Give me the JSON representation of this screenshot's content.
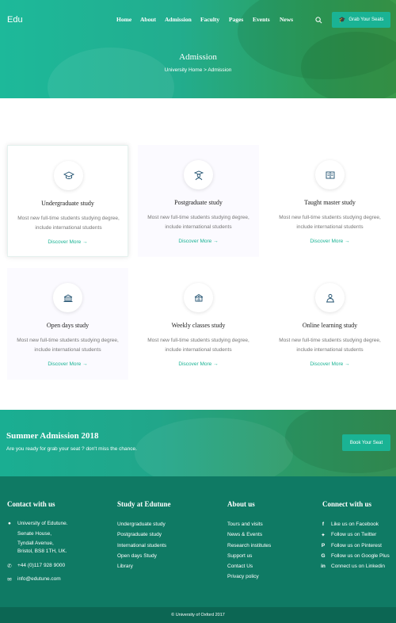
{
  "logo": "Edu",
  "nav": [
    "Home",
    "About",
    "Admission",
    "Faculty",
    "Pages",
    "Events",
    "News"
  ],
  "header": {
    "cta_label": "Grab Your Seats",
    "cta_icon": "graduation-cap-icon"
  },
  "hero": {
    "title": "Admission",
    "breadcrumb": "University Home  >  Admission"
  },
  "cards": [
    {
      "title": "Undergraduate study",
      "desc": "Most new full-time students studying degree, include international students",
      "link": "Discover More  →",
      "icon": "graduation-cap-icon"
    },
    {
      "title": "Postgraduate  study",
      "desc": "Most new full-time students studying degree, include international students",
      "link": "Discover More  →",
      "icon": "graduate-person-icon"
    },
    {
      "title": "Taught master study",
      "desc": "Most new full-time students studying degree, include international students",
      "link": "Discover More  →",
      "icon": "open-book-icon"
    },
    {
      "title": "Open days study",
      "desc": "Most new full-time students studying degree, include international students",
      "link": "Discover More  →",
      "icon": "school-building-icon"
    },
    {
      "title": "Weekly classes study",
      "desc": "Most new full-time students studying degree, include international students",
      "link": "Discover More  →",
      "icon": "classroom-icon"
    },
    {
      "title": "Online learning study",
      "desc": "Most new full-time students studying degree, include international students",
      "link": "Discover More  →",
      "icon": "online-learning-icon"
    }
  ],
  "banner": {
    "title": "Summer Admission 2018",
    "subtitle": "Are you ready for grab your seat ? don't miss the chance.",
    "button": "Book Your Seat"
  },
  "footer": {
    "contact": {
      "heading": "Contact with us",
      "address": [
        "University of Edutune.",
        "Senate House,",
        "Tyndall Avenue,",
        "Bristol, BS8 1TH, UK."
      ],
      "phone": "+44 (0)117 928 9000",
      "email": "info@edutune.com"
    },
    "study": {
      "heading": "Study at Edutune",
      "links": [
        "Undergraduate study",
        "Postgraduate study",
        "International students",
        "Open days Study",
        "Library"
      ]
    },
    "about": {
      "heading": "About us",
      "links": [
        "Tours and visits",
        "News & Events",
        "Research institutes",
        "Support us",
        "Contact Us",
        "Privacy policy"
      ]
    },
    "connect": {
      "heading": "Connect with us",
      "links": [
        "Like us on Facebook",
        "Follow us on Twitter",
        "Follow us on Pinterest",
        "Follow us on Google Plus",
        "Connect us on Linkedin"
      ]
    },
    "copyright": "© University of Oxford 2017"
  },
  "colors": {
    "accent": "#1ab394",
    "footer": "#0f7a64",
    "footer_bottom": "#0c6653"
  }
}
